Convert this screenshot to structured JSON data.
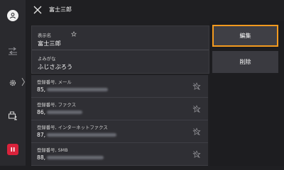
{
  "header": {
    "title": "富士三郎"
  },
  "info": {
    "display_name_label": "表示名",
    "display_name_value": "富士三郎",
    "reading_label": "よみがな",
    "reading_value": "ふじさぶろう"
  },
  "registers": [
    {
      "label": "登録番号, メール",
      "number": "85,"
    },
    {
      "label": "登録番号, ファクス",
      "number": "86,"
    },
    {
      "label": "登録番号, インターネットファクス",
      "number": "87,"
    },
    {
      "label": "登録番号, SMB",
      "number": "88,"
    }
  ],
  "actions": {
    "edit_label": "編集",
    "delete_label": "削除"
  },
  "colors": {
    "accent": "#f39a1e",
    "danger": "#d9223b",
    "background": "#1f1f22",
    "panel": "#2f2f34"
  },
  "icons": {
    "rail": [
      "user-icon",
      "swap-arrows-icon",
      "gear-icon",
      "printer-person-icon",
      "pause-icon"
    ],
    "header": "close-icon",
    "favorite": "star-outline-icon",
    "favorite_off": "star-off-icon"
  }
}
